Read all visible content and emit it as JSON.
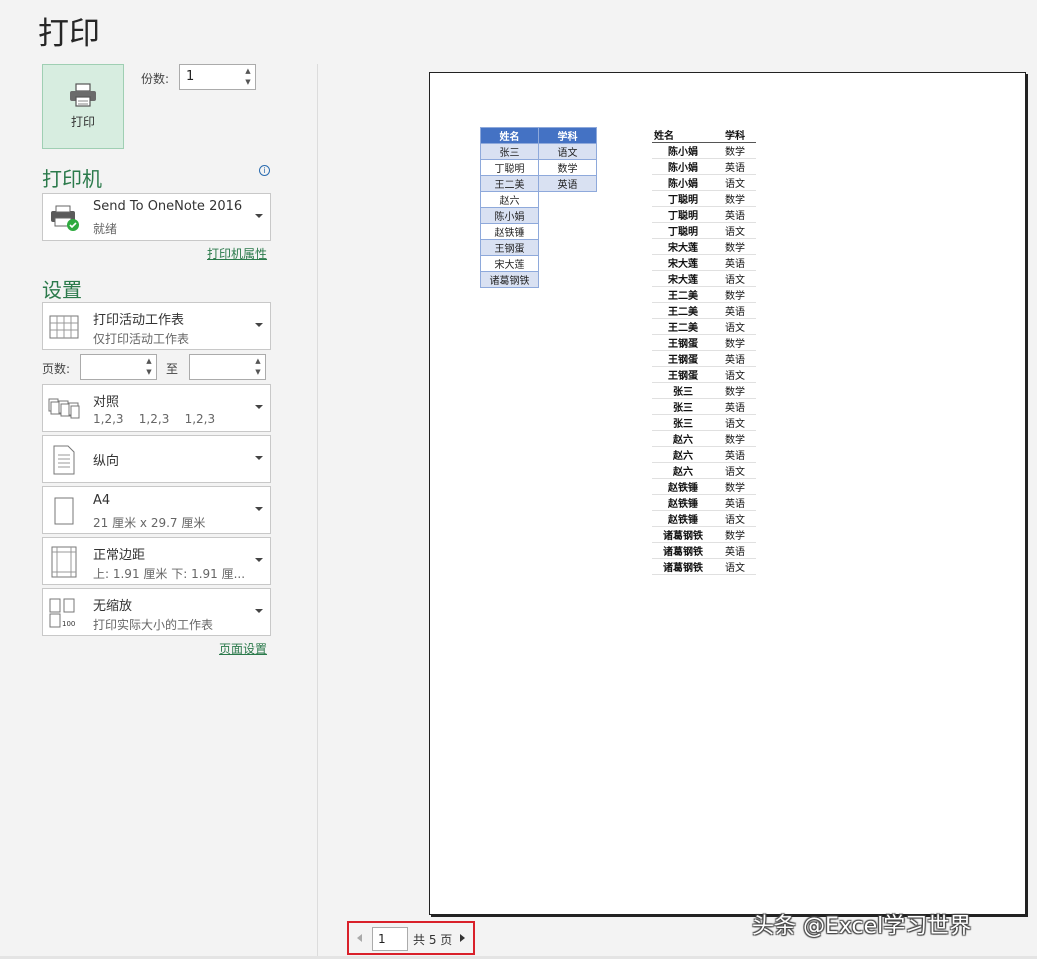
{
  "title": "打印",
  "print_button": {
    "label": "打印",
    "icon": "printer-icon"
  },
  "copies": {
    "label": "份数:",
    "value": "1"
  },
  "printer_section": {
    "heading": "打印机",
    "printer_name": "Send To OneNote 2016",
    "printer_status": "就绪",
    "properties_link": "打印机属性"
  },
  "settings_section": {
    "heading": "设置",
    "items": [
      {
        "line1": "打印活动工作表",
        "line2": "仅打印活动工作表",
        "icon": "worksheet-icon"
      },
      {
        "line1": "对照",
        "line2": "1,2,3    1,2,3    1,2,3",
        "icon": "collate-icon"
      },
      {
        "line1": "纵向",
        "line2": "",
        "icon": "portrait-icon"
      },
      {
        "line1": "A4",
        "line2": "21 厘米 x 29.7 厘米",
        "icon": "paper-size-icon"
      },
      {
        "line1": "正常边距",
        "line2": "上: 1.91 厘米 下: 1.91 厘...",
        "icon": "margins-icon"
      },
      {
        "line1": "无缩放",
        "line2": "打印实际大小的工作表",
        "icon": "scaling-icon"
      }
    ],
    "pages_label": "页数:",
    "to_label": "至",
    "page_setup_link": "页面设置"
  },
  "preview": {
    "table1": {
      "headers": [
        "姓名",
        "学科"
      ],
      "names": [
        "张三",
        "丁聪明",
        "王二美",
        "赵六",
        "陈小娟",
        "赵铁锤",
        "王钢蛋",
        "宋大莲",
        "诸葛钢铁"
      ],
      "subjects": [
        "语文",
        "数学",
        "英语"
      ]
    },
    "table2": {
      "headers": [
        "姓名",
        "学科"
      ],
      "rows": [
        [
          "陈小娟",
          "数学"
        ],
        [
          "陈小娟",
          "英语"
        ],
        [
          "陈小娟",
          "语文"
        ],
        [
          "丁聪明",
          "数学"
        ],
        [
          "丁聪明",
          "英语"
        ],
        [
          "丁聪明",
          "语文"
        ],
        [
          "宋大莲",
          "数学"
        ],
        [
          "宋大莲",
          "英语"
        ],
        [
          "宋大莲",
          "语文"
        ],
        [
          "王二美",
          "数学"
        ],
        [
          "王二美",
          "英语"
        ],
        [
          "王二美",
          "语文"
        ],
        [
          "王钢蛋",
          "数学"
        ],
        [
          "王钢蛋",
          "英语"
        ],
        [
          "王钢蛋",
          "语文"
        ],
        [
          "张三",
          "数学"
        ],
        [
          "张三",
          "英语"
        ],
        [
          "张三",
          "语文"
        ],
        [
          "赵六",
          "数学"
        ],
        [
          "赵六",
          "英语"
        ],
        [
          "赵六",
          "语文"
        ],
        [
          "赵铁锤",
          "数学"
        ],
        [
          "赵铁锤",
          "英语"
        ],
        [
          "赵铁锤",
          "语文"
        ],
        [
          "诸葛钢铁",
          "数学"
        ],
        [
          "诸葛钢铁",
          "英语"
        ],
        [
          "诸葛钢铁",
          "语文"
        ]
      ]
    }
  },
  "page_nav": {
    "current": "1",
    "total": "共 5 页"
  },
  "watermark": "头条 @Excel学习世界",
  "colors": {
    "accent": "#2b7a4b",
    "print_button_bg": "#d7ede0",
    "table_header": "#4472c4",
    "table_band": "#d9e1f2",
    "highlight_border": "#d9202a"
  }
}
